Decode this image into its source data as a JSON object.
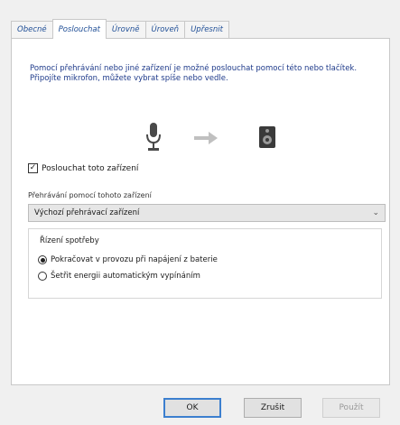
{
  "tabs": [
    "Obecné",
    "Poslouchat",
    "Úrovně",
    "Úroveň",
    "Upřesnit"
  ],
  "active_tab_index": 1,
  "description": "Pomocí přehrávání nebo jiné zařízení je možné poslouchat pomocí této nebo tlačítek. Připojíte mikrofon, můžete vybrat spíše nebo vedle.",
  "listen_checkbox": {
    "label": "Poslouchat toto zařízení",
    "checked": true
  },
  "playback_label": "Přehrávání pomocí tohoto zařízení",
  "playback_select": {
    "value": "Výchozí přehrávací zařízení"
  },
  "power_group": {
    "title": "Řízení spotřeby",
    "options": [
      {
        "label": "Pokračovat v provozu při napájení z baterie",
        "selected": true
      },
      {
        "label": "Šetřit energii automatickým vypínáním",
        "selected": false
      }
    ]
  },
  "buttons": {
    "ok": "OK",
    "cancel": "Zrušit",
    "apply": "Použít"
  },
  "icons": {
    "source": "microphone-icon",
    "direction": "arrow-right-icon",
    "target": "speaker-icon"
  }
}
